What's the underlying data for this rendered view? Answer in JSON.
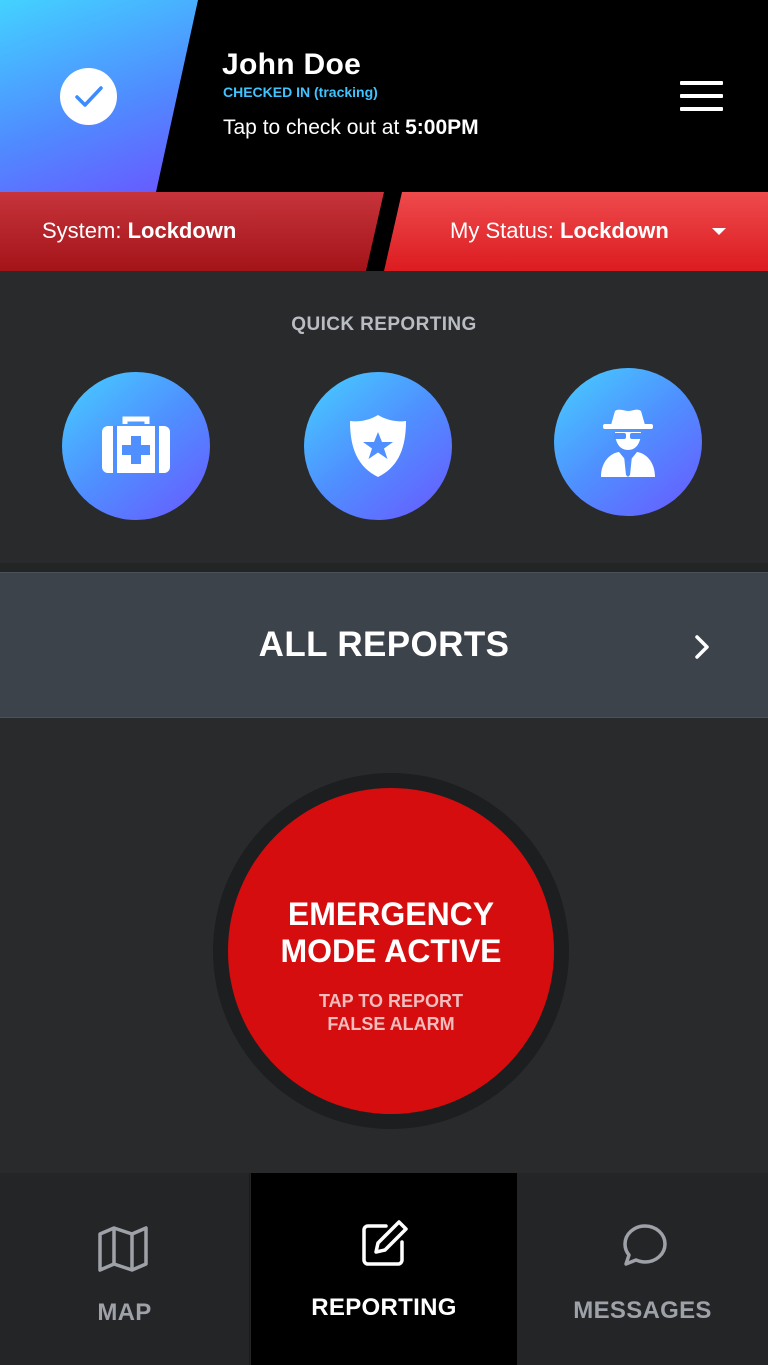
{
  "header": {
    "user_name": "John Doe",
    "checkin_status": "CHECKED IN (tracking)",
    "checkout_prefix": "Tap to check out at ",
    "checkout_time": "5:00PM",
    "check_icon": "checkmark-icon",
    "menu_icon": "hamburger-menu-icon"
  },
  "status": {
    "system_label": "System: ",
    "system_value": "Lockdown",
    "my_label": "My Status: ",
    "my_value": "Lockdown"
  },
  "quick_reporting": {
    "title": "QUICK REPORTING",
    "buttons": [
      {
        "icon": "medical-kit-icon"
      },
      {
        "icon": "police-badge-icon"
      },
      {
        "icon": "suspicious-person-icon"
      }
    ]
  },
  "all_reports": {
    "label": "ALL REPORTS"
  },
  "emergency": {
    "title_line1": "EMERGENCY",
    "title_line2": "MODE ACTIVE",
    "sub_line1": "TAP TO REPORT",
    "sub_line2": "FALSE ALARM"
  },
  "nav": {
    "items": [
      {
        "label": "MAP",
        "icon": "map-icon",
        "active": false
      },
      {
        "label": "REPORTING",
        "icon": "edit-icon",
        "active": true
      },
      {
        "label": "MESSAGES",
        "icon": "chat-bubble-icon",
        "active": false
      }
    ]
  },
  "colors": {
    "accent_blue": "#43d2ff",
    "accent_purple": "#6a55ff",
    "emergency_red": "#d60d0e",
    "lockdown_red": "#dc1c20"
  }
}
